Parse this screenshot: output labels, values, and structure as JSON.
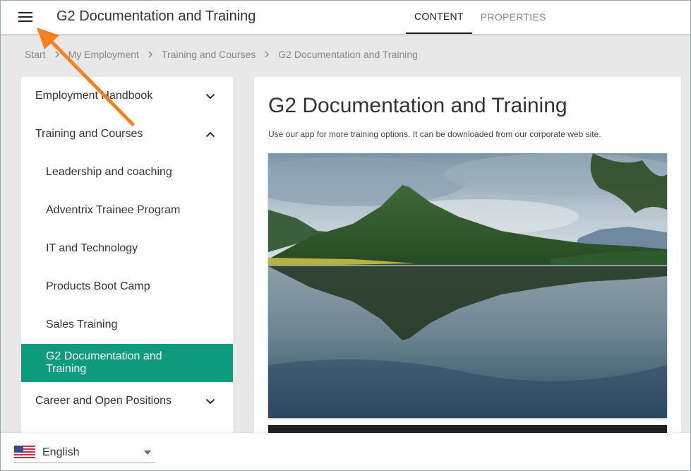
{
  "header": {
    "title": "G2 Documentation and Training",
    "tabs": [
      {
        "label": "CONTENT",
        "active": true
      },
      {
        "label": "PROPERTIES",
        "active": false
      }
    ]
  },
  "breadcrumb": [
    "Start",
    "My Employment",
    "Training and Courses",
    "G2 Documentation and Training"
  ],
  "sidebar": {
    "items": [
      {
        "label": "Employment Handbook",
        "chevron": "chevron-down"
      },
      {
        "label": "Training and Courses",
        "chevron": "chevron-up"
      },
      {
        "label": "Leadership and coaching"
      },
      {
        "label": "Adventrix Trainee Program"
      },
      {
        "label": "IT and Technology"
      },
      {
        "label": "Products Boot Camp"
      },
      {
        "label": "Sales Training"
      },
      {
        "label": "G2 Documentation and Training",
        "active": true
      },
      {
        "label": "Career and Open Positions",
        "chevron": "chevron-down"
      }
    ]
  },
  "main": {
    "title": "G2 Documentation and Training",
    "intro": "Use our app for more training options. It can be downloaded from our corporate web site."
  },
  "language": {
    "selected": "English",
    "flag": "us-flag-icon"
  },
  "colors": {
    "accent": "#0e9b7e",
    "annotation_arrow": "#f5821f"
  }
}
